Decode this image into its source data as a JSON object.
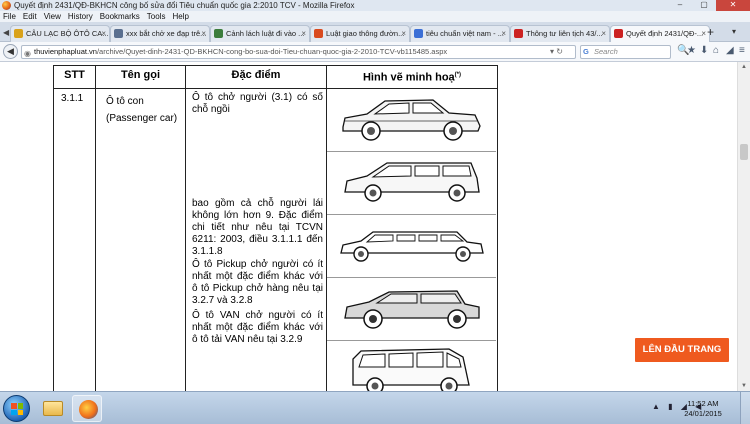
{
  "window": {
    "title": "Quyết định 2431/QĐ-BKHCN công bố sửa đổi Tiêu chuẩn quốc gia 2:2010 TCV - Mozilla Firefox",
    "controls": [
      "–",
      "▢",
      "✕"
    ]
  },
  "menu": [
    "File",
    "Edit",
    "View",
    "History",
    "Bookmarks",
    "Tools",
    "Help"
  ],
  "tabs": [
    {
      "label": "CÂU LẠC BỘ ÔTÔ CA...",
      "icon_color": "#d9a21b"
    },
    {
      "label": "xxx bắt chở xe đạp trê...",
      "icon_color": "#5a6f8f"
    },
    {
      "label": "Cảnh lách luật đi vào ...",
      "icon_color": "#3c7d3c"
    },
    {
      "label": "Luật giao thông đườn...",
      "icon_color": "#d94a1e"
    },
    {
      "label": "tiêu chuẩn việt nam - ...",
      "icon_color": "#3b6fd6"
    },
    {
      "label": "Thông tư liên tịch 43/...",
      "icon_color": "#cc2222"
    },
    {
      "label": "Quyết định 2431/QĐ-...",
      "icon_color": "#cc2222"
    }
  ],
  "nav": {
    "url_domain": "thuvienphapluat.vn",
    "url_path": "/archive/Quyet-dinh-2431-QD-BKHCN-cong-bo-sua-doi-Tieu-chuan-quoc-gia-2-2010-TCV-vb115485.aspx",
    "search_placeholder": "Search",
    "search_engine_letter": "G"
  },
  "table": {
    "headers": {
      "stt": "STT",
      "ten_goi": "Tên gọi",
      "dac_diem": "Đặc điểm",
      "hinh_ve": "Hình vẽ minh hoạ",
      "hinh_ve_sup": "(*)"
    },
    "row": {
      "stt": "3.1.1",
      "ten_goi": "Ô tô con",
      "ten_goi_en": "(Passenger car)",
      "dac_diem_1": "Ô tô chở người (3.1) có số chỗ ngồi",
      "dac_diem_2": "bao gồm cả chỗ người lái không lớn hơn 9. Đặc điểm chi tiết như nêu tại TCVN 6211: 2003, điều 3.1.1.1 đến 3.1.1.8",
      "dac_diem_3": "Ô tô Pickup chở người có ít nhất một đặc điểm khác với ô tô Pickup chở hàng nêu tại 3.2.7 và 3.2.8",
      "dac_diem_4": "Ô tô VAN chở người có ít nhất một đặc điểm khác với ô tô tải VAN nêu tại 3.2.9"
    },
    "illustrations": [
      "sedan-icon",
      "station-wagon-icon",
      "limousine-icon",
      "convertible-icon",
      "minivan-icon"
    ]
  },
  "back_to_top": "LÊN ĐẦU TRANG",
  "taskbar": {
    "time": "11:52 AM",
    "date": "24/01/2015",
    "tray": "▲ ▮ ◢ ◀"
  },
  "colors": {
    "accent_orange": "#ef5a1f",
    "chrome_blue": "#d3dce8"
  }
}
